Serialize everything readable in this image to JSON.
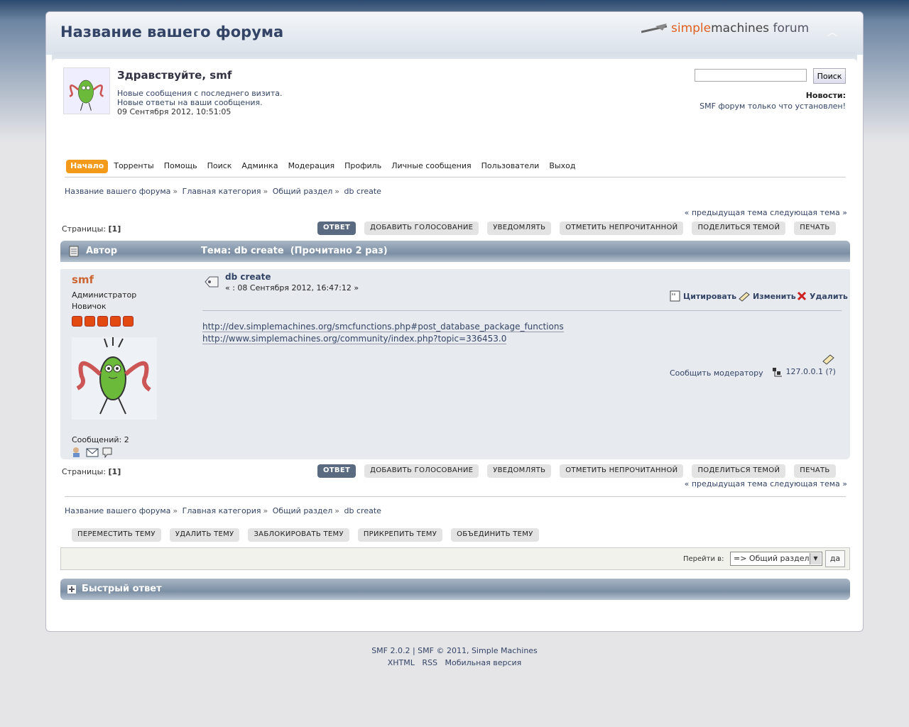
{
  "header": {
    "forum_name": "Название вашего форума",
    "logo_simple": "simple",
    "logo_machines": "machines",
    "logo_forum": "forum"
  },
  "user": {
    "greeting": "Здравствуйте, smf",
    "new_posts": "Новые сообщения с последнего визита.",
    "new_replies": "Новые ответы на ваши сообщения.",
    "datetime": "09 Сентября 2012, 10:51:05"
  },
  "search": {
    "value": "",
    "button": "Поиск"
  },
  "news": {
    "label": "Новости:",
    "text": "SMF форум только что установлен!"
  },
  "menu": [
    "Начало",
    "Торренты",
    "Помощь",
    "Поиск",
    "Админка",
    "Модерация",
    "Профиль",
    "Личные сообщения",
    "Пользователи",
    "Выход"
  ],
  "breadcrumb": [
    "Название вашего форума",
    "Главная категория",
    "Общий раздел",
    "db create"
  ],
  "breadcrumb_sep": "»",
  "prevnext": "« предыдущая тема следующая тема »",
  "pages_label": "Страницы:",
  "pages_value": "[1]",
  "topic_buttons": [
    "ОТВЕТ",
    "ДОБАВИТЬ ГОЛОСОВАНИЕ",
    "УВЕДОМЛЯТЬ",
    "ОТМЕТИТЬ НЕПРОЧИТАННОЙ",
    "ПОДЕЛИТЬСЯ ТЕМОЙ",
    "ПЕЧАТЬ"
  ],
  "header_bar": {
    "author": "Автор",
    "topic": "Тема: db create  (Прочитано 2 раз)"
  },
  "post": {
    "poster": "smf",
    "role": "Администратор",
    "rank": "Новичок",
    "posts_count": "Сообщений: 2",
    "title": "db create",
    "date": "« : 08 Сентября 2012, 16:47:12 »",
    "quote": "Цитировать",
    "edit": "Изменить",
    "delete": "Удалить",
    "link1": "http://dev.simplemachines.org/smcfunctions.php#post_database_package_functions",
    "link2": "http://www.simplemachines.org/community/index.php?topic=336453.0",
    "report": "Сообщить модератору",
    "ip": "127.0.0.1 (?)"
  },
  "mod_buttons": [
    "ПЕРЕМЕСТИТЬ ТЕМУ",
    "УДАЛИТЬ ТЕМУ",
    "ЗАБЛОКИРОВАТЬ ТЕМУ",
    "ПРИКРЕПИТЬ ТЕМУ",
    "ОБЪЕДИНИТЬ ТЕМУ"
  ],
  "jump": {
    "label": "Перейти в:",
    "selected": "=> Общий раздел",
    "go": "да"
  },
  "quick_reply": "Быстрый ответ",
  "footer": {
    "line1": "SMF 2.0.2 | SMF © 2011, Simple Machines",
    "xhtml": "XHTML",
    "rss": "RSS",
    "mobile": "Мобильная версия"
  },
  "colors": {
    "accent": "#f49a1a",
    "poster_name": "#cc6633",
    "link": "#334466"
  }
}
